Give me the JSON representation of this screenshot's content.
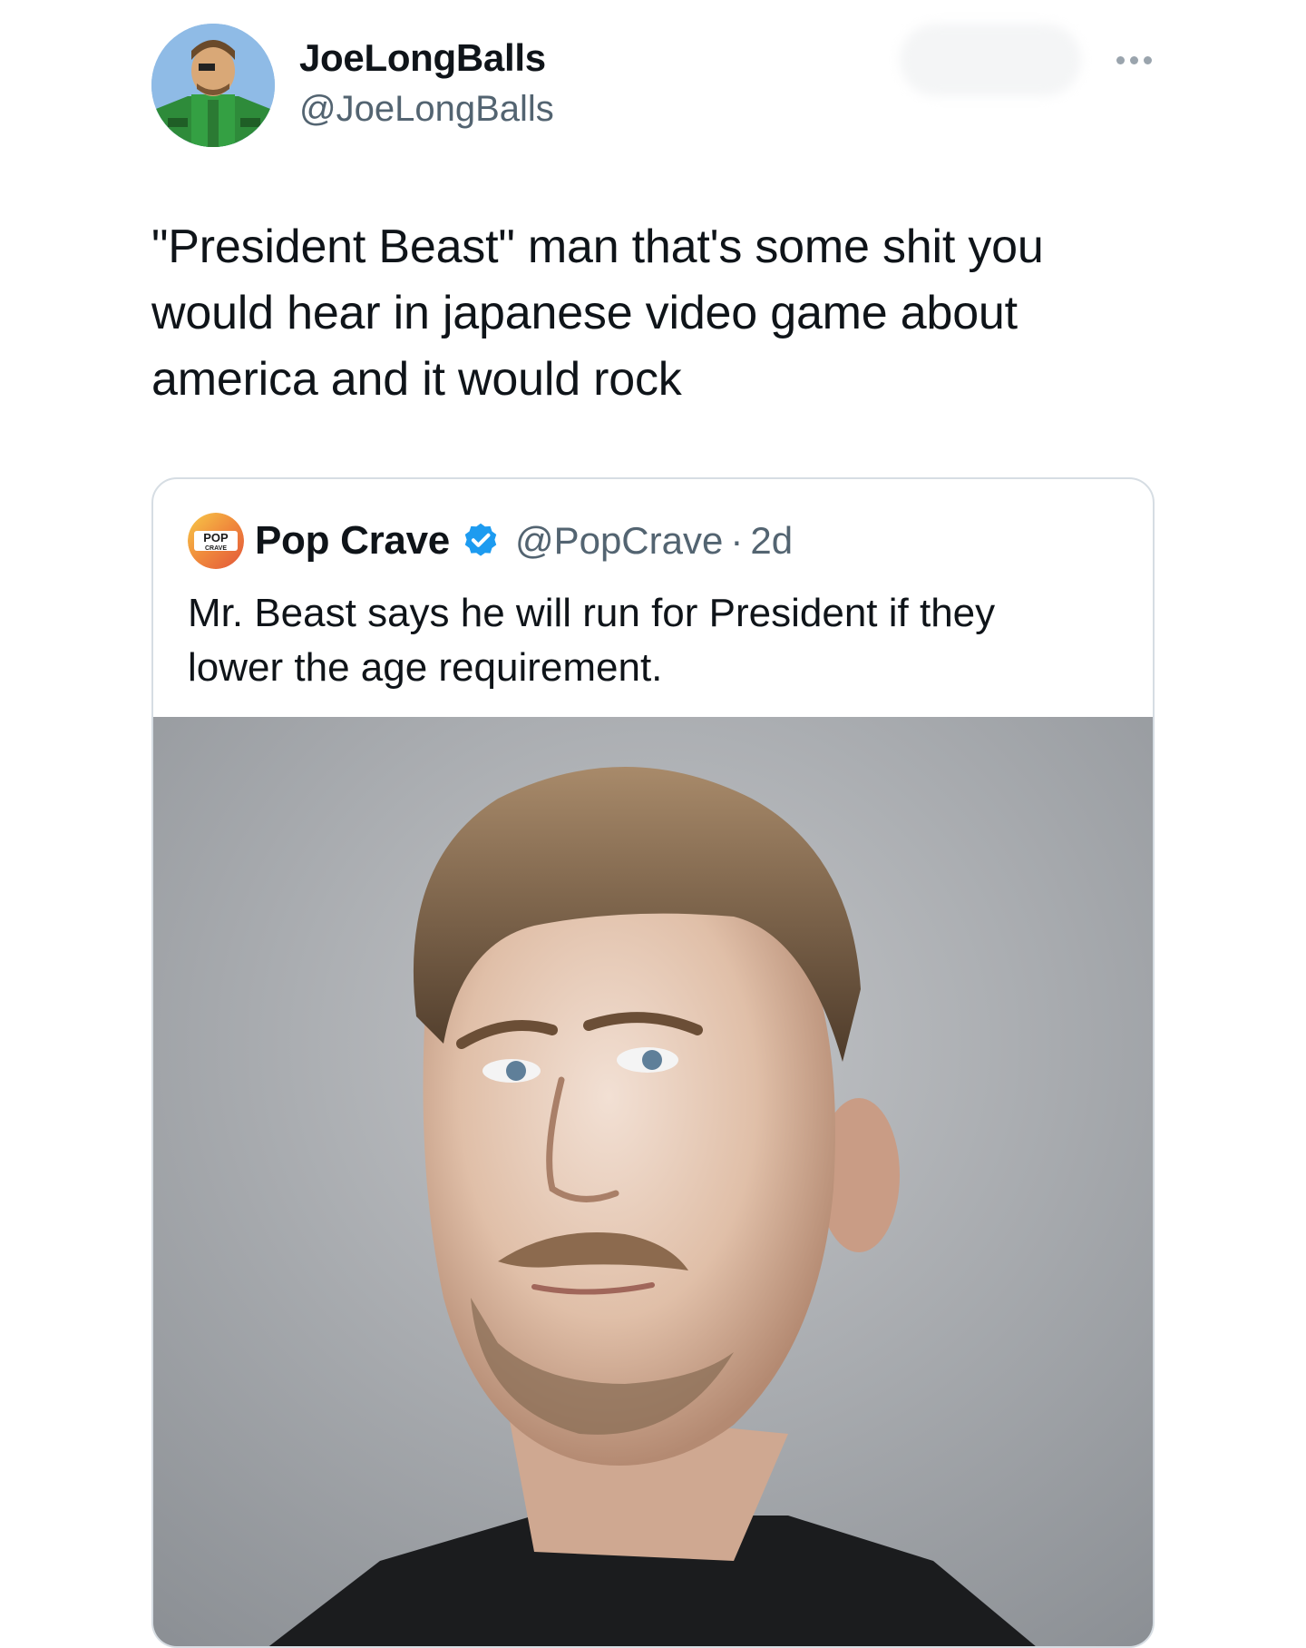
{
  "author": {
    "display_name": "JoeLongBalls",
    "handle": "@JoeLongBalls",
    "avatar_icon": "cartoon-soldier-avatar-icon"
  },
  "more_icon": "more-horizontal-icon",
  "tweet": {
    "lines": [
      "\"President Beast\" man that's some shit you",
      "would hear in japanese video game about",
      "america and it would rock"
    ]
  },
  "quoted_tweet": {
    "avatar_text_top": "POP",
    "avatar_text_bottom": "CRAVE",
    "display_name": "Pop Crave",
    "verified_icon": "verified-badge-icon",
    "handle": "@PopCrave",
    "separator": "·",
    "time": "2d",
    "lines": [
      "Mr. Beast says he will run for President if they",
      "lower the age requirement."
    ]
  },
  "colors": {
    "text_primary": "#0f1419",
    "text_secondary": "#536471",
    "verified_blue": "#1d9bf0",
    "card_border": "#d6dde3"
  }
}
